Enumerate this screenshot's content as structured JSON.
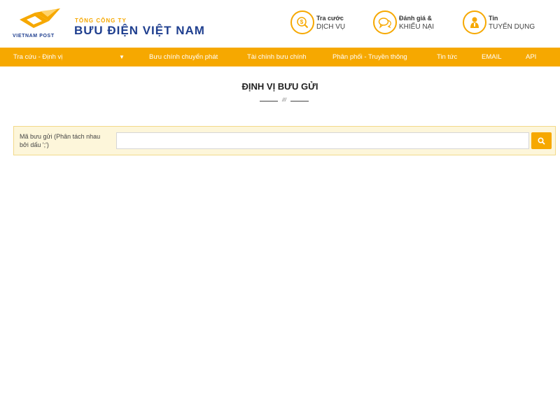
{
  "logo": {
    "text": "VIETNAM POST",
    "brand_small": "TỔNG CÔNG TY",
    "brand_big": "BƯU ĐIỆN VIỆT NAM",
    "icon": "vietnam-post-logo"
  },
  "header_links": [
    {
      "line1": "Tra cước",
      "line2": "DỊCH VỤ",
      "icon": "dollar-icon"
    },
    {
      "line1": "Đánh giá &",
      "line2": "KHIẾU NẠI",
      "icon": "chat-bubbles-icon"
    },
    {
      "line1": "Tin",
      "line2": "TUYỂN DỤNG",
      "icon": "person-icon"
    }
  ],
  "nav": {
    "items": [
      "Tra cứu - Định vị",
      "Bưu chính chuyển phát",
      "Tài chính bưu chính",
      "Phân phối - Truyền thông",
      "Tin tức",
      "EMAIL",
      "API"
    ],
    "caret": "▼"
  },
  "page": {
    "title": "ĐỊNH VỊ BƯU GỬI",
    "divider_mark": "///"
  },
  "search": {
    "label": "Mã bưu gửi (Phân tách nhau bởi dấu ';')",
    "value": "",
    "placeholder": "",
    "button_icon": "search-icon"
  },
  "colors": {
    "accent": "#f6a800",
    "brand_blue": "#1f3f8f",
    "panel_bg": "#fdf6da"
  }
}
